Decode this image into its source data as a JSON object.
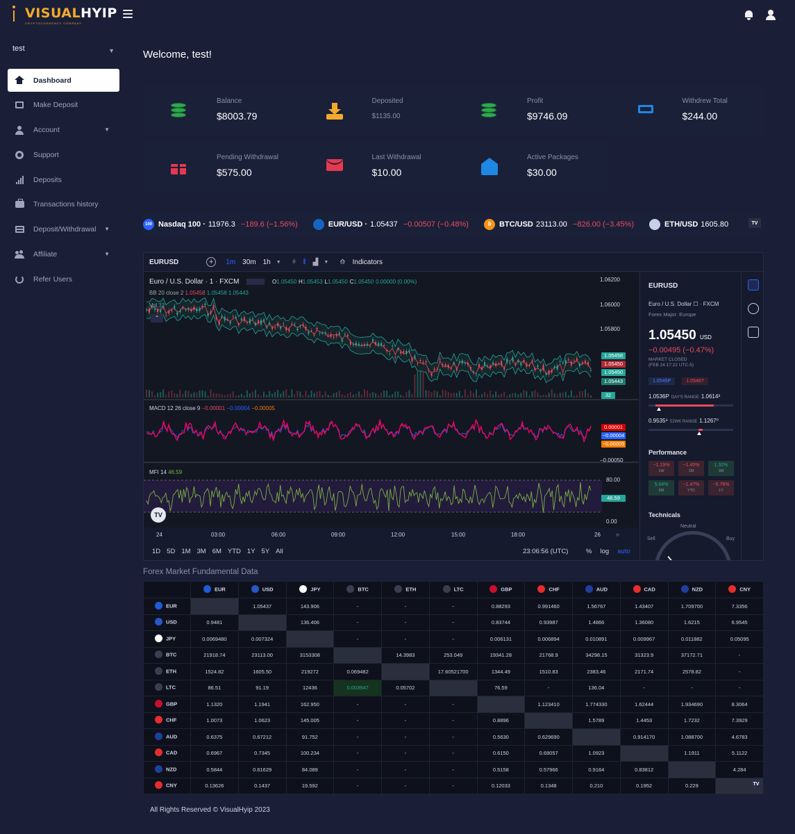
{
  "header": {
    "logo_main": "VISUAL",
    "logo_accent": "HYIP",
    "logo_sub": "CRYPTOCURRENCY COMPANY"
  },
  "sidebar": {
    "user": "test",
    "items": [
      {
        "label": "Dashboard",
        "icon": "home-icon",
        "active": true,
        "submenu": false
      },
      {
        "label": "Make Deposit",
        "icon": "card-icon",
        "active": false,
        "submenu": false
      },
      {
        "label": "Account",
        "icon": "person-icon",
        "active": false,
        "submenu": true
      },
      {
        "label": "Support",
        "icon": "lifebuoy-icon",
        "active": false,
        "submenu": false
      },
      {
        "label": "Deposits",
        "icon": "bars-icon",
        "active": false,
        "submenu": false
      },
      {
        "label": "Transactions history",
        "icon": "briefcase-icon",
        "active": false,
        "submenu": false
      },
      {
        "label": "Deposit/Withdrawal",
        "icon": "cards-icon",
        "active": false,
        "submenu": true
      },
      {
        "label": "Affiliate",
        "icon": "users-icon",
        "active": false,
        "submenu": true
      },
      {
        "label": "Refer Users",
        "icon": "recycle-icon",
        "active": false,
        "submenu": false
      }
    ]
  },
  "main": {
    "welcome": "Welcome, test!",
    "stats": [
      {
        "label": "Balance",
        "value": "$8003.79",
        "icon": "coins-icon",
        "color": "#2fa84f"
      },
      {
        "label": "Deposited",
        "value": "$1135.00",
        "icon": "download-icon",
        "color": "#f3a92b"
      },
      {
        "label": "Profit",
        "value": "$9746.09",
        "icon": "coins-icon",
        "color": "#2fa84f"
      },
      {
        "label": "Withdrew Total",
        "value": "$244.00",
        "icon": "swap-icon",
        "color": "#1e88e5"
      },
      {
        "label": "Pending Withdrawal",
        "value": "$575.00",
        "icon": "gift-icon",
        "color": "#e53950"
      },
      {
        "label": "Last Withdrawal",
        "value": "$10.00",
        "icon": "envelope-icon",
        "color": "#e53950"
      },
      {
        "label": "Active Packages",
        "value": "$30.00",
        "icon": "envelope-open-icon",
        "color": "#1e88e5"
      }
    ]
  },
  "ticker": [
    {
      "badge": "100",
      "badge_color": "#2962ff",
      "name": "Nasdaq 100 ·",
      "price": "11976.3",
      "change": "−189.6 (−1.56%)"
    },
    {
      "badge": "",
      "badge_color": "#1565c0",
      "name": "EUR/USD ·",
      "price": "1.05437",
      "change": "−0.00507 (−0.48%)"
    },
    {
      "badge": "₿",
      "badge_color": "#f7931a",
      "name": "BTC/USD",
      "price": "23113.00",
      "change": "−826.00 (−3.45%)"
    },
    {
      "badge": "",
      "badge_color": "#c8cfe8",
      "name": "ETH/USD",
      "price": "1605.80",
      "change": ""
    }
  ],
  "chart": {
    "symbol": "EURUSD",
    "timeframes": [
      "1m",
      "30m",
      "1h"
    ],
    "indicators_label": "Indicators",
    "title": "Euro / U.S. Dollar · 1 · FXCM",
    "ohlc": {
      "o": "1.05450",
      "h": "1.05453",
      "l": "1.05450",
      "c": "1.05450",
      "chg": "0.00000 (0.00%)"
    },
    "bb": {
      "label": "BB 20 close 2",
      "v1": "1.05458",
      "v2": "1.05458",
      "v3": "1.05443"
    },
    "vol": {
      "label": "Vol",
      "value": "32"
    },
    "macd": {
      "label": "MACD 12 26 close 9",
      "v1": "−0.00001",
      "v2": "−0.00004",
      "v3": "−0.00005"
    },
    "mfi": {
      "label": "MFI 14",
      "value": "46.59"
    },
    "price_axis": [
      "1.06200",
      "1.06000",
      "1.05800"
    ],
    "price_tags": [
      "1.05458",
      "1.05450",
      "1.05450",
      "1.05443",
      "32"
    ],
    "macd_tags": [
      "0.00001",
      "−0.00004",
      "−0.00005"
    ],
    "macd_axis": "−0.00050",
    "mfi_axis": [
      "80.00",
      "0.00"
    ],
    "mfi_tag": "46.59",
    "time_axis": [
      "24",
      "03:00",
      "06:00",
      "09:00",
      "12:00",
      "15:00",
      "18:00",
      "26"
    ],
    "ranges": [
      "1D",
      "5D",
      "1M",
      "3M",
      "6M",
      "YTD",
      "1Y",
      "5Y",
      "All"
    ],
    "clock": "23:06:56 (UTC)",
    "opts": [
      "%",
      "log",
      "auto"
    ]
  },
  "symbol_panel": {
    "symbol": "EURUSD",
    "full_name": "Euro / U.S. Dollar ☐ · FXCM",
    "sub": "Forex Major: Europe",
    "price": "1.05450",
    "currency": "USD",
    "change": "−0.00495 (−0.47%)",
    "market": "MARKET CLOSED",
    "market_time": "(FEB 24 17:22 UTC-5)",
    "bid": "1.0545P",
    "ask": "1.0546?",
    "day_low": "1.0536P",
    "day_label": "DAY'S RANGE",
    "day_high": "1.0614³",
    "wk_low": "0.9535⁹",
    "wk_label": "52WK RANGE",
    "wk_high": "1.1267⁰",
    "performance_title": "Performance",
    "performance": [
      {
        "value": "−1.19%",
        "period": "1W",
        "sign": "neg"
      },
      {
        "value": "−1.40%",
        "period": "1M",
        "sign": "neg"
      },
      {
        "value": "1.32%",
        "period": "3M",
        "sign": "pos"
      },
      {
        "value": "5.64%",
        "period": "6M",
        "sign": "pos"
      },
      {
        "value": "−1.47%",
        "period": "YTD",
        "sign": "neg"
      },
      {
        "value": "−5.76%",
        "period": "1Y",
        "sign": "neg"
      }
    ],
    "technicals_title": "Technicals",
    "gauge_neutral": "Neutral",
    "gauge_sell": "Sell",
    "gauge_buy": "Buy"
  },
  "forex": {
    "title": "Forex Market Fundamental Data",
    "currencies": [
      {
        "code": "EUR",
        "color": "#1e5bd8"
      },
      {
        "code": "USD",
        "color": "#2a56c6"
      },
      {
        "code": "JPY",
        "color": "#ffffff"
      },
      {
        "code": "BTC",
        "color": "#3a3f50"
      },
      {
        "code": "ETH",
        "color": "#3a3f50"
      },
      {
        "code": "LTC",
        "color": "#3a3f50"
      },
      {
        "code": "GBP",
        "color": "#c8102e"
      },
      {
        "code": "CHF",
        "color": "#e52d2d"
      },
      {
        "code": "AUD",
        "color": "#1f3f9c"
      },
      {
        "code": "CAD",
        "color": "#e52d2d"
      },
      {
        "code": "NZD",
        "color": "#1f3f9c"
      },
      {
        "code": "CNY",
        "color": "#e52d2d"
      }
    ],
    "rows": [
      [
        "",
        "1.05437",
        "143.906",
        "-",
        "-",
        "-",
        "0.88293",
        "0.991460",
        "1.56767",
        "1.43407",
        "1.709700",
        "7.3356"
      ],
      [
        "0.9481",
        "",
        "136.406",
        "-",
        "-",
        "-",
        "0.83744",
        "0.93987",
        "1.4866",
        "1.36080",
        "1.6215",
        "6.9545"
      ],
      [
        "0.0069480",
        "0.007324",
        "",
        "-",
        "-",
        "-",
        "0.006131",
        "0.006894",
        "0.010891",
        "0.009967",
        "0.011882",
        "0.05095"
      ],
      [
        "21918.74",
        "23113.00",
        "3153308",
        "",
        "14.3983",
        "253.049",
        "19341.28",
        "21768.9",
        "34298.15",
        "31323.9",
        "37172.71",
        "-"
      ],
      [
        "1524.82",
        "1605.50",
        "219272",
        "0.069482",
        "",
        "17.60521700",
        "1344.49",
        "1510.83",
        "2383.46",
        "2171.74",
        "2578.82",
        "-"
      ],
      [
        "86.51",
        "91.19",
        "12436",
        "0.003947",
        "0.05702",
        "",
        "76.59",
        "-",
        "136.04",
        "-",
        "-",
        "-"
      ],
      [
        "1.1320",
        "1.1941",
        "162.950",
        "-",
        "-",
        "-",
        "",
        "1.123410",
        "1.774330",
        "1.62444",
        "1.934690",
        "8.3064"
      ],
      [
        "1.0073",
        "1.0623",
        "145.005",
        "-",
        "-",
        "-",
        "0.8896",
        "",
        "1.5789",
        "1.4453",
        "1.7232",
        "7.3929"
      ],
      [
        "0.6375",
        "0.67212",
        "91.752",
        "-",
        "-",
        "-",
        "0.5630",
        "0.629690",
        "",
        "0.914170",
        "1.088700",
        "4.6783"
      ],
      [
        "0.6967",
        "0.7345",
        "100.234",
        "-",
        "-",
        "-",
        "0.6150",
        "0.69057",
        "1.0923",
        "",
        "1.1911",
        "5.1122"
      ],
      [
        "0.5844",
        "0.61629",
        "84.089",
        "-",
        "-",
        "-",
        "0.5158",
        "0.57966",
        "0.9164",
        "0.83812",
        "",
        "4.284"
      ],
      [
        "0.13626",
        "0.1437",
        "19.592",
        "-",
        "-",
        "-",
        "0.12033",
        "0.1348",
        "0.210",
        "0.1952",
        "0.229",
        ""
      ]
    ],
    "highlight": {
      "row": 5,
      "col": 3
    }
  },
  "footer": "All Rights Reserved © VisualHyip 2023"
}
